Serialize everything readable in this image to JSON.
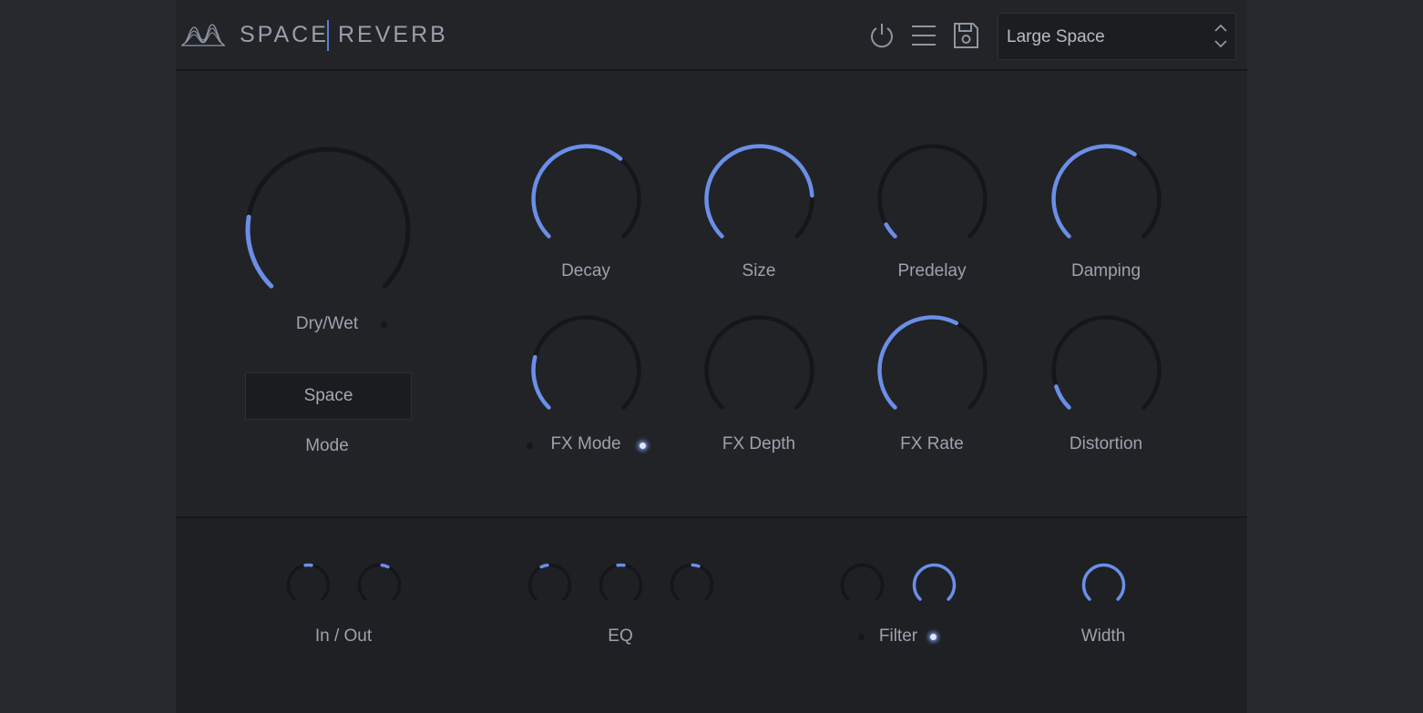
{
  "header": {
    "brand_left": "SPACE",
    "brand_right": "REVERB",
    "icons": [
      "logo-waves-icon",
      "power-icon",
      "menu-icon",
      "save-icon",
      "chevron-up-down-icon"
    ],
    "preset": {
      "value": "Large Space"
    }
  },
  "colors": {
    "accent": "#6b8fe8",
    "track": "#141619",
    "label": "#9ca3ad",
    "panel": "#212327"
  },
  "main": {
    "dry_wet": {
      "label": "Dry/Wet",
      "level": 0.2
    },
    "mode": {
      "label": "Mode",
      "value": "Space"
    },
    "knobs": [
      {
        "label": "Decay",
        "level": 0.65
      },
      {
        "label": "Size",
        "level": 0.82
      },
      {
        "label": "Predelay",
        "level": 0.06
      },
      {
        "label": "Damping",
        "level": 0.62
      },
      {
        "label": "FX Mode",
        "level": 0.22
      },
      {
        "label": "FX Depth",
        "level": 0.0
      },
      {
        "label": "FX Rate",
        "level": 0.6
      },
      {
        "label": "Distortion",
        "level": 0.1
      }
    ]
  },
  "bottom": {
    "in_out": {
      "label": "In / Out",
      "levels": [
        0.5,
        0.56
      ]
    },
    "eq": {
      "label": "EQ",
      "levels": [
        0.44,
        0.5,
        0.54
      ]
    },
    "filter": {
      "label": "Filter",
      "levels": [
        0.0,
        1.0
      ]
    },
    "width": {
      "label": "Width",
      "level": 1.0
    }
  }
}
